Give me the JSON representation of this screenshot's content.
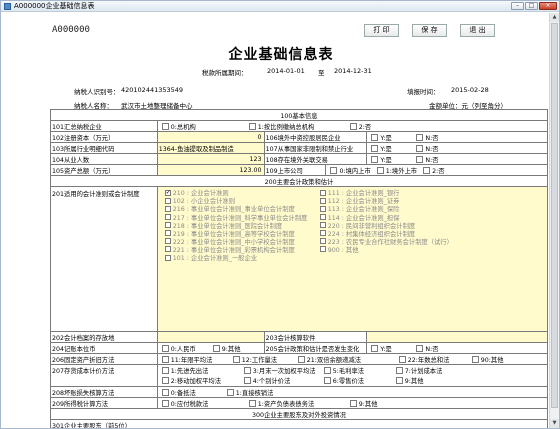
{
  "window": {
    "title": "A000000企业基础信息表",
    "buttons": {
      "minimize": "–",
      "maximize": "□",
      "close": "×"
    }
  },
  "doc": {
    "id": "A000000",
    "title": "企业基础信息表"
  },
  "toolbar": {
    "print": "打 印",
    "save": "保 存",
    "exit": "退 出"
  },
  "period": {
    "label": "税款所属期间：",
    "start": "2014-01-01",
    "sep": "至",
    "end": "2014-12-31"
  },
  "taxpayer": {
    "id_label": "纳税人识别号：",
    "id_value": "420102441353549",
    "fill_date_label": "填报时间：",
    "fill_date": "2015-02-28",
    "name_label": "纳税人名称：",
    "name_value": "武汉市土地整理储备中心",
    "unit_label": "金额单位：元（列至角分）"
  },
  "sections": {
    "s100": "100基本信息",
    "s200": "200主要会计政策和估计",
    "s300": "300企业主要股东及对外投资情况"
  },
  "rows": {
    "r101": {
      "label": "101汇总纳税企业",
      "opts": [
        "0:总机构",
        "1:按比例缴纳总机构",
        "2:否"
      ]
    },
    "r102": {
      "label": "102注册资本（万元）",
      "value": "0",
      "r2label": "106境外中资控股居民企业",
      "opts": [
        "Y:是",
        "N:否"
      ]
    },
    "r103": {
      "label": "103所属行业明细代码",
      "value": "1364-鱼油提取及制品制造",
      "r2label": "107从事国家非限制和禁止行业",
      "opts": [
        "Y:是",
        "N:否"
      ]
    },
    "r104": {
      "label": "104从业人数",
      "value": "123",
      "r2label": "108存在境外关联交易",
      "opts": [
        "Y:是",
        "N:否"
      ]
    },
    "r105": {
      "label": "105资产总额（万元）",
      "value": "123.00",
      "r2label": "109上市公司",
      "opts": [
        "0:境内上市",
        "1:境外上市",
        "2:否"
      ]
    },
    "r201": {
      "label": "201适用的会计准则或会计制度",
      "items": [
        {
          "t": "210 : 企业会计准则",
          "on": true
        },
        {
          "t": "111 : 企业会计准则_银行",
          "on": false
        },
        {
          "t": "102 : 小企业会计准则",
          "on": false
        },
        {
          "t": "112 : 企业会计准则_证券",
          "on": false
        },
        {
          "t": "216 : 事业单位会计准则_事业单位会计制度",
          "on": false
        },
        {
          "t": "113 : 企业会计准则_保险",
          "on": false
        },
        {
          "t": "217 : 事业单位会计准则_科学事业单位会计制度",
          "on": false
        },
        {
          "t": "114 : 企业会计准则_担保",
          "on": false
        },
        {
          "t": "218 : 事业单位会计准则_医院会计制度",
          "on": false
        },
        {
          "t": "220 : 民间非营利组织会计制度",
          "on": false
        },
        {
          "t": "219 : 事业单位会计准则_高等学校会计制度",
          "on": false
        },
        {
          "t": "224 : 村集体经济组织会计制度",
          "on": false
        },
        {
          "t": "222 : 事业单位会计准则_中小学校会计制度",
          "on": false
        },
        {
          "t": "223 : 农民专业合作社财务会计制度（试行）",
          "on": false
        },
        {
          "t": "221 : 事业单位会计准则_彩票机构会计制度",
          "on": false
        },
        {
          "t": "900 : 其他",
          "on": false
        },
        {
          "t": "101 : 企业会计准则_一般企业",
          "on": false
        }
      ]
    },
    "r202": {
      "label": "202会计档案的存放地",
      "r2label": "203会计核算软件"
    },
    "r204": {
      "label": "204记账本位币",
      "opts": [
        "0:人民币",
        "9:其他"
      ],
      "r2label": "205会计政策和估计是否发生变化",
      "opts2": [
        "Y:是",
        "N:否"
      ]
    },
    "r206": {
      "label": "206固定资产折旧方法",
      "opts": [
        "11:年限平均法",
        "12:工作量法",
        "21:双倍余额递减法",
        "22:年数总和法",
        "90:其他"
      ]
    },
    "r207": {
      "label": "207存货成本计价方法",
      "opts": [
        "1:先进先出法",
        "3:月末一次加权平均法",
        "5:毛利率法",
        "7:计划成本法",
        "2:移动加权平均法",
        "4:个别计价法",
        "6:零售价法",
        "9:其他"
      ]
    },
    "r208": {
      "label": "208坏账损失核算方法",
      "opts": [
        "0:备抵法",
        "1:直接核销法"
      ]
    },
    "r209": {
      "label": "209所得税计算方法",
      "opts": [
        "0:应付税款法",
        "1:资产负债表债务法",
        "9:其他"
      ]
    },
    "r301": {
      "label": "301企业主要股东（前5位）"
    }
  }
}
